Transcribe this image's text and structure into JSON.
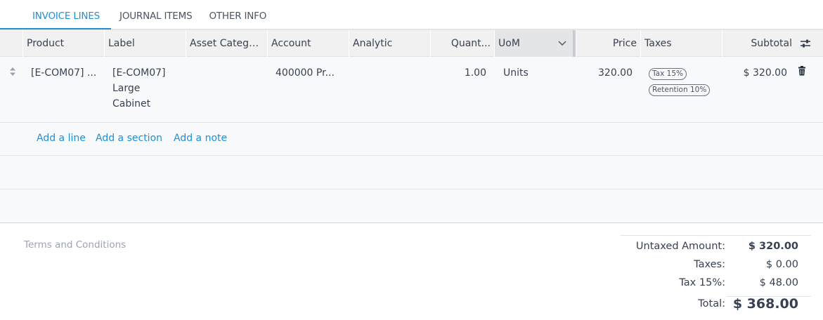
{
  "tabs": [
    {
      "label": "INVOICE LINES",
      "active": true
    },
    {
      "label": "JOURNAL ITEMS",
      "active": false
    },
    {
      "label": "OTHER INFO",
      "active": false
    }
  ],
  "table": {
    "headers": {
      "product": "Product",
      "label": "Label",
      "asset_category": "Asset Catego...",
      "account": "Account",
      "analytic": "Analytic",
      "quantity": "Quant...",
      "uom": "UoM",
      "price": "Price",
      "taxes": "Taxes",
      "subtotal": "Subtotal"
    },
    "rows": [
      {
        "product": "[E-COM07] ...",
        "label_line1": "[E-COM07]",
        "label_line2": "Large",
        "label_line3": "Cabinet",
        "asset_category": "",
        "account": "400000 Pr...",
        "analytic": "",
        "quantity": "1.00",
        "uom": "Units",
        "price": "320.00",
        "taxes": [
          "Tax 15%",
          "Retention 10%"
        ],
        "subtotal": "$ 320.00"
      }
    ],
    "actions": {
      "add_line": "Add a line",
      "add_section": "Add a section",
      "add_note": "Add a note"
    }
  },
  "terms_placeholder": "Terms and Conditions",
  "totals": {
    "untaxed_label": "Untaxed Amount:",
    "untaxed_value": "$ 320.00",
    "taxes_label": "Taxes:",
    "taxes_value": "$ 0.00",
    "tax15_label": "Tax 15%:",
    "tax15_value": "$ 48.00",
    "total_label": "Total:",
    "total_value": "$ 368.00"
  },
  "colors": {
    "accent": "#1f8fd6",
    "header_bg": "#f1f1f2",
    "row_bg": "#f8f9fa"
  }
}
